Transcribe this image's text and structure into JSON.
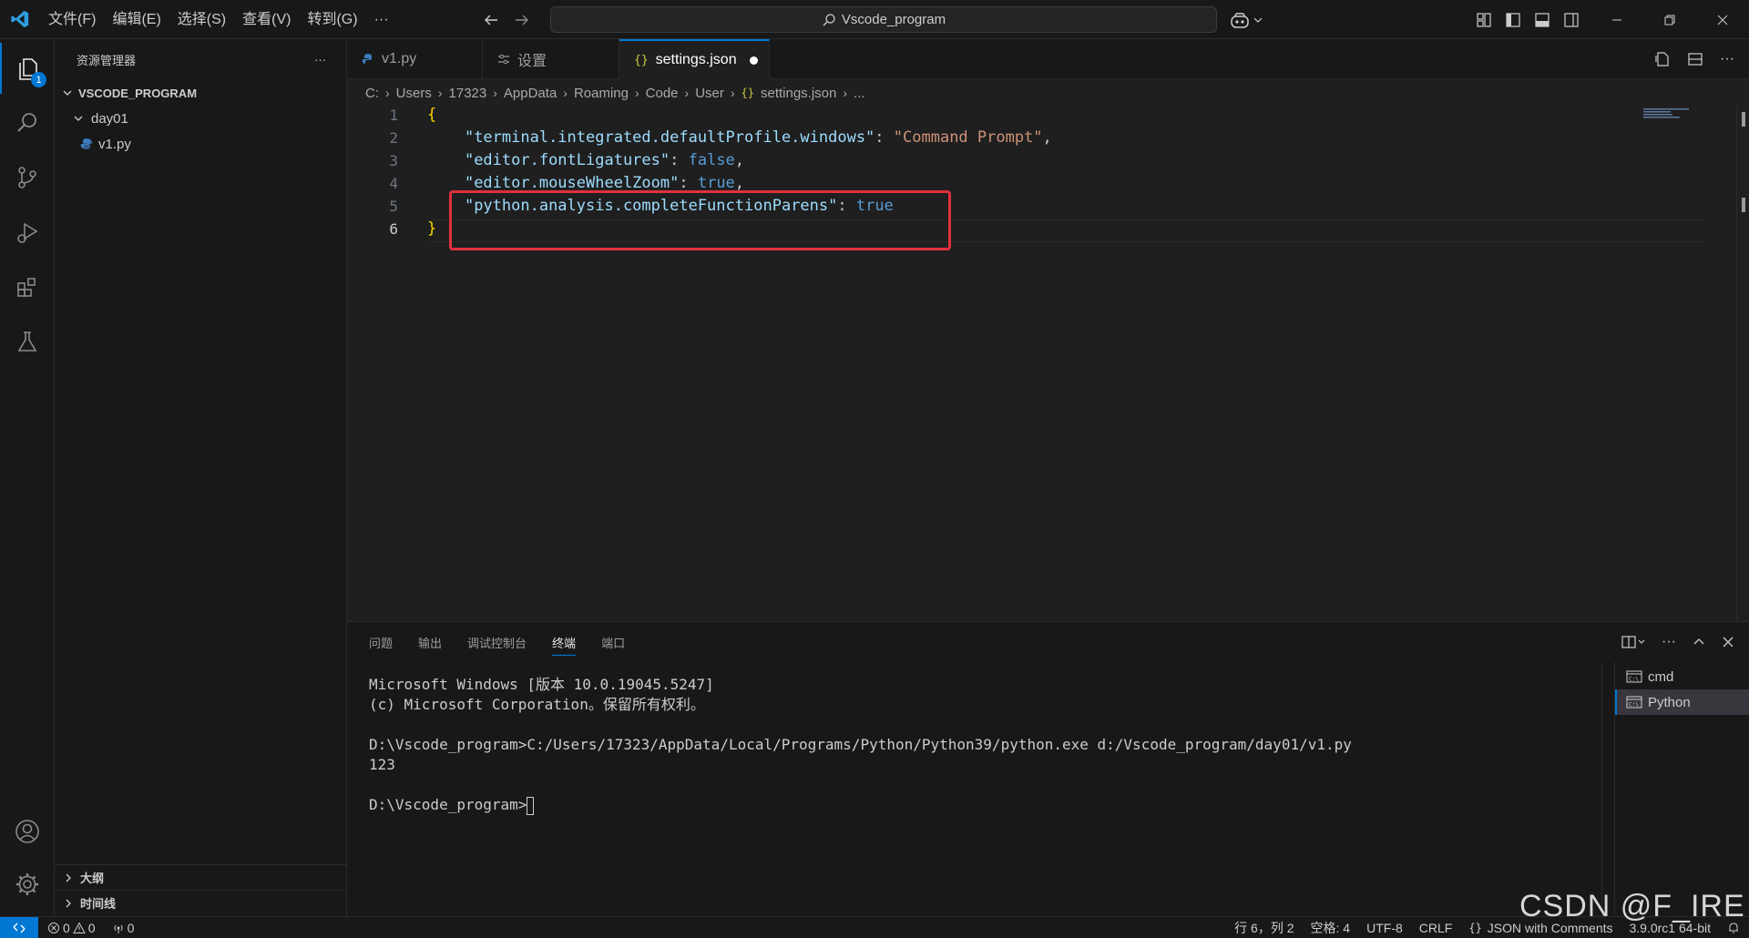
{
  "titlebar": {
    "menu": [
      "文件(F)",
      "编辑(E)",
      "选择(S)",
      "查看(V)",
      "转到(G)",
      "···"
    ],
    "search_text": "Vscode_program"
  },
  "activity": {
    "explorer_badge": "1"
  },
  "sidebar": {
    "title": "资源管理器",
    "more": "···",
    "project": "VSCODE_PROGRAM",
    "folder": "day01",
    "file": "v1.py",
    "outline": "大纲",
    "timeline": "时间线"
  },
  "tabs": [
    {
      "label": "v1.py"
    },
    {
      "label": "设置"
    },
    {
      "label": "settings.json",
      "modified": true
    }
  ],
  "breadcrumb": [
    "C:",
    "Users",
    "17323",
    "AppData",
    "Roaming",
    "Code",
    "User",
    "settings.json",
    "..."
  ],
  "editor": {
    "line_numbers": [
      "1",
      "2",
      "3",
      "4",
      "5",
      "6"
    ],
    "lines": [
      {
        "open": "{"
      },
      {
        "key": "\"terminal.integrated.defaultProfile.windows\"",
        "sep": ": ",
        "value": "\"Command Prompt\"",
        "vtype": "s",
        "tail": ","
      },
      {
        "key": "\"editor.fontLigatures\"",
        "sep": ": ",
        "value": "false",
        "vtype": "b",
        "tail": ","
      },
      {
        "key": "\"editor.mouseWheelZoom\"",
        "sep": ": ",
        "value": "true",
        "vtype": "b",
        "tail": ","
      },
      {
        "key": "\"python.analysis.completeFunctionParens\"",
        "sep": ": ",
        "value": "true",
        "vtype": "b",
        "tail": ""
      },
      {
        "close": "}"
      }
    ]
  },
  "panel": {
    "tabs": [
      "问题",
      "输出",
      "调试控制台",
      "终端",
      "端口"
    ],
    "active_tab": "终端",
    "terminal_lines": [
      "Microsoft Windows [版本 10.0.19045.5247]",
      "(c) Microsoft Corporation。保留所有权利。",
      "",
      "D:\\Vscode_program>C:/Users/17323/AppData/Local/Programs/Python/Python39/python.exe d:/Vscode_program/day01/v1.py",
      "123",
      ""
    ],
    "prompt": "D:\\Vscode_program>",
    "terminals": [
      "cmd",
      "Python"
    ]
  },
  "status": {
    "errors": "0",
    "warnings": "0",
    "ports": "0",
    "position": "行 6，列 2",
    "spaces": "空格: 4",
    "encoding": "UTF-8",
    "eol": "CRLF",
    "language": "JSON with Comments",
    "interpreter": "3.9.0rc1 64-bit"
  },
  "watermark": "CSDN @F_IRE",
  "colors": {
    "accent": "#0078d4",
    "highlight_box": "#e0303d"
  }
}
